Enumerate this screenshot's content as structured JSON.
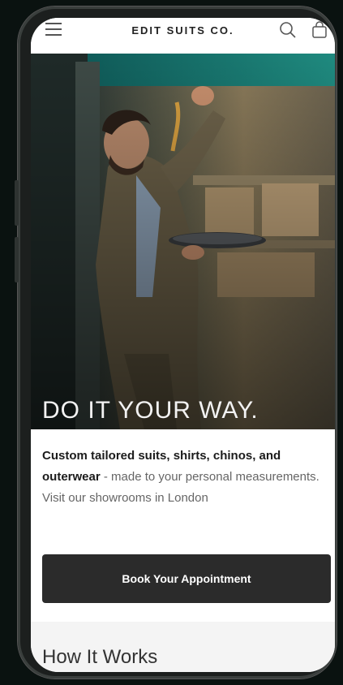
{
  "header": {
    "brand": "EDIT SUITS CO.",
    "menu_icon": "hamburger-menu-icon",
    "search_icon": "search-icon",
    "cart_icon": "shopping-bag-icon"
  },
  "hero": {
    "headline": "DO IT YOUR WAY."
  },
  "intro": {
    "bold_text": "Custom tailored suits, shirts, chinos, and outerwear",
    "text": " - made to your personal measurements. Visit our showrooms in London"
  },
  "cta": {
    "label": "Book Your Appointment"
  },
  "section": {
    "title": "How It Works"
  },
  "colors": {
    "cta_background": "#2b2b2b",
    "page_background": "#0a1210"
  }
}
